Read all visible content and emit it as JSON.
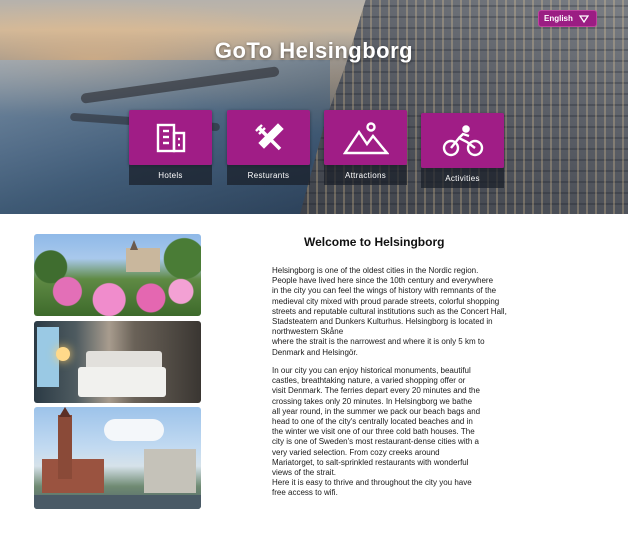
{
  "header": {
    "title": "GoTo Helsingborg",
    "language": {
      "selected": "English",
      "icon": "triangle-down-icon"
    }
  },
  "categories": [
    {
      "label": "Hotels",
      "icon": "building-icon"
    },
    {
      "label": "Resturants",
      "icon": "fork-knife-icon"
    },
    {
      "label": "Attractions",
      "icon": "mountain-icon"
    },
    {
      "label": "Activities",
      "icon": "bicycle-icon"
    }
  ],
  "colors": {
    "accent": "#a01d86",
    "label_bg": "#1f2530"
  },
  "main": {
    "heading": "Welcome to Helsingborg",
    "paragraph1": [
      "Helsingborg is one of the oldest cities in the Nordic region.",
      "People have lived here since the 10th century and everywhere",
      "in the city you can feel the wings of history with remnants of the",
      "medieval city mixed with proud parade streets, colorful shopping",
      "streets and reputable cultural institutions such as the Concert Hall,",
      "Stadsteatern and Dunkers Kulturhus. Helsingborg is located in",
      "northwestern Skåne",
      "where the strait is the narrowest and where it is only 5 km to",
      "Denmark and Helsingör."
    ],
    "paragraph2": [
      "In our city you can enjoy historical monuments, beautiful",
      "castles, breathtaking nature, a varied shopping offer or",
      "visit Denmark. The ferries depart every 20 minutes and the",
      "crossing takes only 20 minutes. In Helsingborg we bathe",
      "all year round, in the summer we pack our beach bags and",
      "head to one of the city's centrally located beaches and in",
      "the winter we visit one of our three cold bath houses. The",
      "city is one of Sweden's most restaurant-dense cities with a",
      "very varied selection. From cozy creeks around",
      "Mariatorget, to salt-sprinkled restaurants with wonderful",
      "views of the strait.",
      "Here it is easy to thrive and throughout the city you have",
      "free access to wifi."
    ]
  }
}
